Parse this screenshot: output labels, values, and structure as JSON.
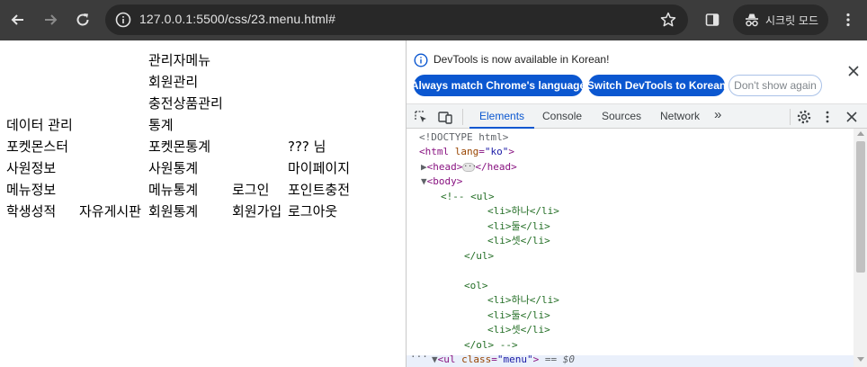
{
  "browser": {
    "url": "127.0.0.1:5500/css/23.menu.html#",
    "incognito_label": "시크릿 모드"
  },
  "page": {
    "menu_items": [
      "관리자메뉴",
      "회원관리",
      "충전상품관리",
      "데이터 관리",
      "통계",
      "포켓몬스터",
      "포켓몬통계",
      "??? 님",
      "사원정보",
      "사원통계",
      "마이페이지",
      "메뉴정보",
      "메뉴통계",
      "로그인",
      "포인트충전",
      "학생성적",
      "자유게시판",
      "회원통계",
      "회원가입",
      "로그아웃"
    ]
  },
  "devtools": {
    "infobar": {
      "message": "DevTools is now available in Korean!",
      "btn_match": "Always match Chrome's language",
      "btn_switch": "Switch DevTools to Korean",
      "btn_dismiss": "Don't show again"
    },
    "tabs": [
      "Elements",
      "Console",
      "Sources",
      "Network"
    ],
    "more_tabs": "»",
    "dom": {
      "doctype": "<!DOCTYPE html>",
      "html_open": "<html",
      "lang_attr": "lang",
      "lang_val": "\"ko\"",
      "head": "<head>",
      "head_close": "</head>",
      "body": "<body>",
      "comment_start": "<!-- <ul>",
      "li1": "<li>하나</li>",
      "li2": "<li>둘</li>",
      "li3": "<li>셋</li>",
      "ul_close": "</ul>",
      "ol_open": "<ol>",
      "ol_close_comment": "</ol> -->",
      "ul_menu_tag": "<ul",
      "class_attr": "class",
      "class_val": "\"menu\"",
      "selected_marker": "== $0"
    }
  },
  "colors": {
    "accent": "#0b57d0",
    "toolbar": "#3c3c3c",
    "tag": "#881280",
    "comment": "#236e25"
  }
}
